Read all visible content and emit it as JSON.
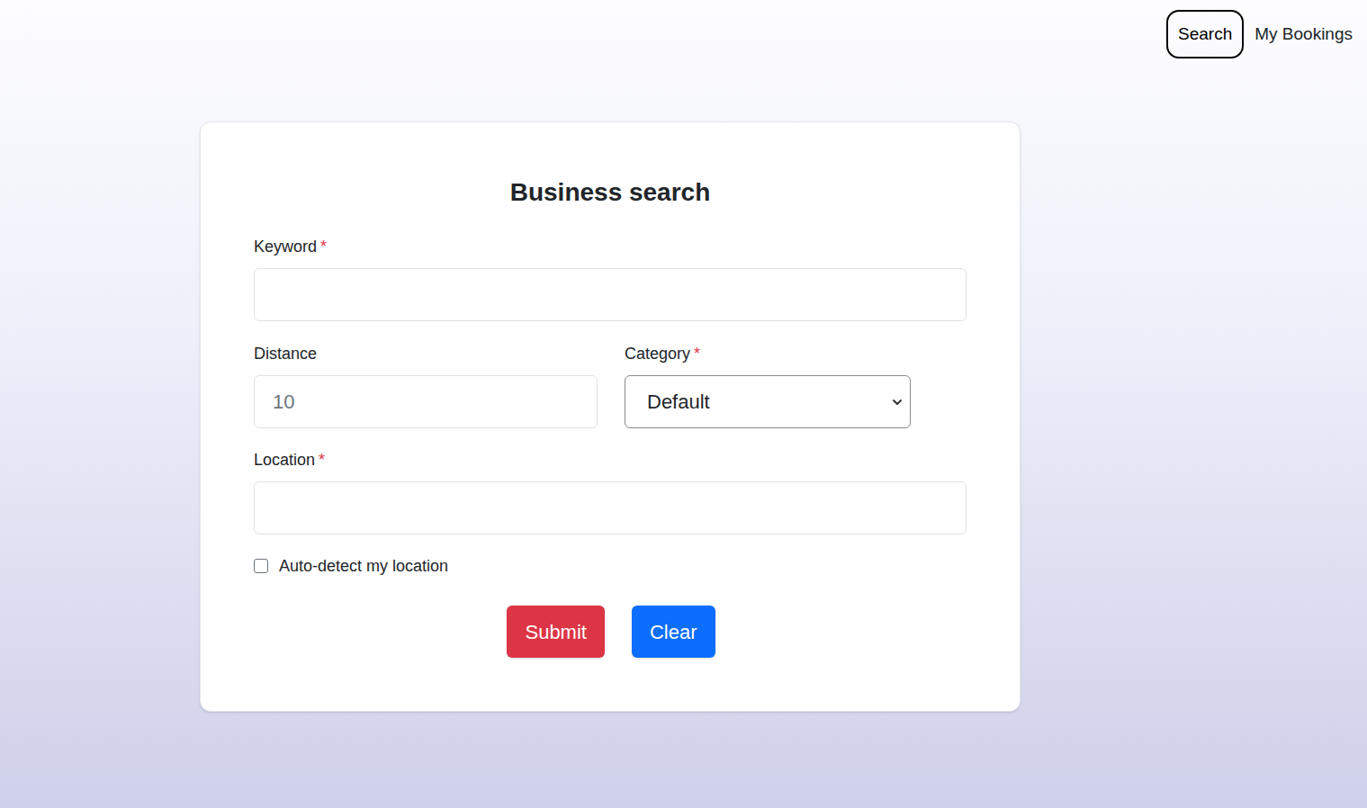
{
  "nav": {
    "items": [
      {
        "label": "Search",
        "selected": true
      },
      {
        "label": "My Bookings",
        "selected": false
      }
    ]
  },
  "form": {
    "title": "Business search",
    "required_mark": "*",
    "keyword": {
      "label": "Keyword",
      "required": true,
      "value": ""
    },
    "distance": {
      "label": "Distance",
      "required": false,
      "placeholder": "10"
    },
    "category": {
      "label": "Category",
      "required": true,
      "value": "Default"
    },
    "location": {
      "label": "Location",
      "required": true,
      "value": ""
    },
    "auto_detect": {
      "label": "Auto-detect my location",
      "checked": false
    },
    "buttons": [
      {
        "label": "Submit",
        "color": "#dc3545"
      },
      {
        "label": "Clear",
        "color": "#0d6efd"
      }
    ]
  }
}
